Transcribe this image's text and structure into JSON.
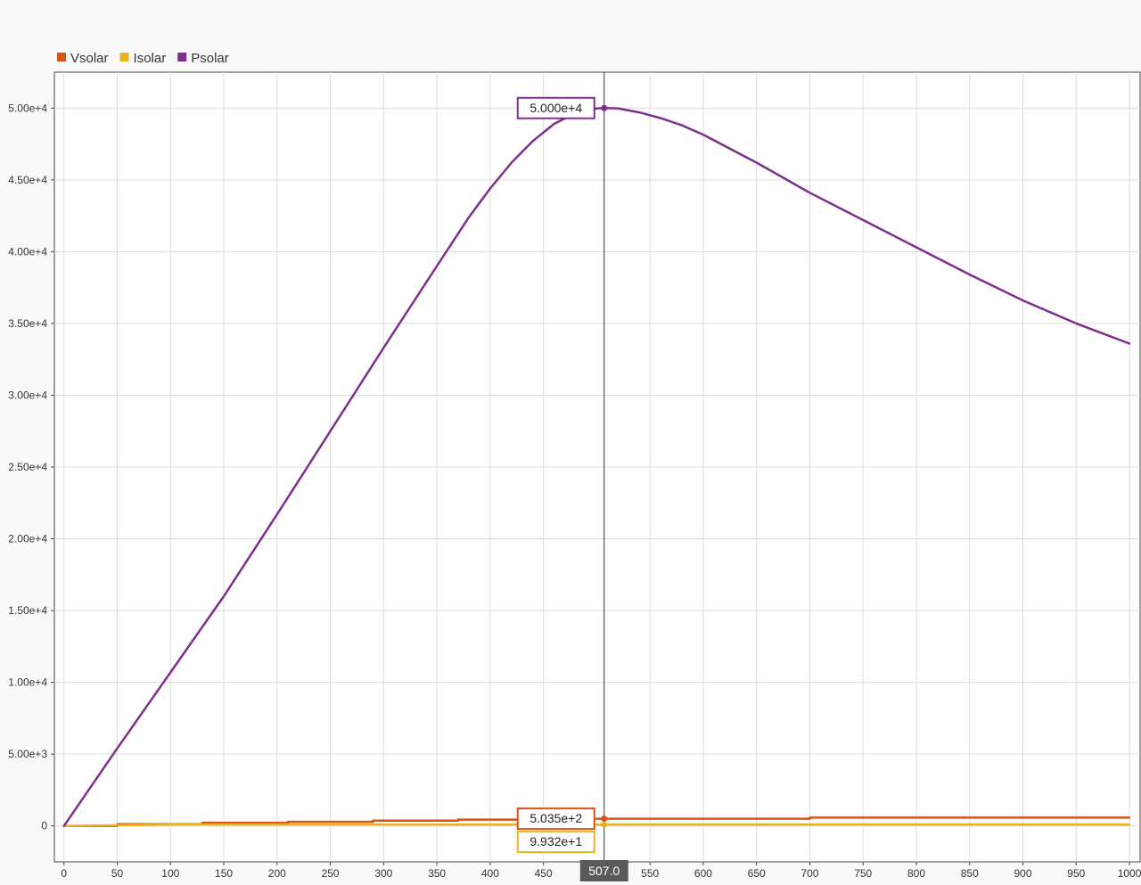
{
  "chart_data": {
    "type": "line",
    "legend": {
      "placement": "top-left"
    },
    "grid": true,
    "xlim": [
      -9,
      1010
    ],
    "ylim": [
      -2500,
      52500
    ],
    "x_ticks": [
      0,
      50,
      100,
      150,
      200,
      250,
      300,
      350,
      400,
      450,
      550,
      600,
      650,
      700,
      750,
      800,
      850,
      900,
      950,
      1000
    ],
    "x_tick_labels": [
      "0",
      "50",
      "100",
      "150",
      "200",
      "250",
      "300",
      "350",
      "400",
      "450",
      "550",
      "600",
      "650",
      "700",
      "750",
      "800",
      "850",
      "900",
      "950",
      "1000"
    ],
    "y_ticks": [
      0,
      5000,
      10000,
      15000,
      20000,
      25000,
      30000,
      35000,
      40000,
      45000,
      50000
    ],
    "y_tick_labels": [
      "0",
      "5.00e+3",
      "1.00e+4",
      "1.50e+4",
      "2.00e+4",
      "2.50e+4",
      "3.00e+4",
      "3.50e+4",
      "4.00e+4",
      "4.50e+4",
      "5.00e+4"
    ],
    "series": [
      {
        "name": "Vsolar",
        "color": "#d95319",
        "style": "step",
        "x": [
          0,
          50,
          50,
          130,
          130,
          210,
          210,
          290,
          290,
          370,
          370,
          450,
          450,
          507,
          700,
          700,
          1000
        ],
        "y": [
          0,
          0,
          120,
          120,
          210,
          210,
          290,
          290,
          370,
          370,
          440,
          440,
          503.5,
          503.5,
          503.5,
          580,
          580
        ]
      },
      {
        "name": "Isolar",
        "color": "#edb120",
        "x": [
          0,
          100,
          300,
          507,
          700,
          1000
        ],
        "y": [
          0,
          99,
          99,
          99.32,
          99,
          99
        ]
      },
      {
        "name": "Psolar",
        "color": "#7e2f8e",
        "x": [
          0,
          50,
          100,
          150,
          200,
          250,
          300,
          350,
          380,
          400,
          420,
          440,
          460,
          480,
          500,
          507,
          520,
          540,
          560,
          580,
          600,
          650,
          700,
          750,
          800,
          850,
          900,
          950,
          1000
        ],
        "y": [
          0,
          5400,
          10700,
          16000,
          21700,
          27500,
          33300,
          39000,
          42400,
          44400,
          46200,
          47700,
          48900,
          49650,
          49980,
          50000,
          49980,
          49700,
          49300,
          48800,
          48150,
          46200,
          44100,
          42200,
          40300,
          38400,
          36600,
          35000,
          33600
        ]
      }
    ],
    "cursor": {
      "x": 507,
      "label": "507.0",
      "readouts": [
        {
          "series": "Psolar",
          "y": 50000,
          "label": "5.000e+4"
        },
        {
          "series": "Vsolar",
          "y": 503.5,
          "label": "5.035e+2"
        },
        {
          "series": "Isolar",
          "y": 99.32,
          "label": "9.932e+1"
        }
      ]
    }
  }
}
